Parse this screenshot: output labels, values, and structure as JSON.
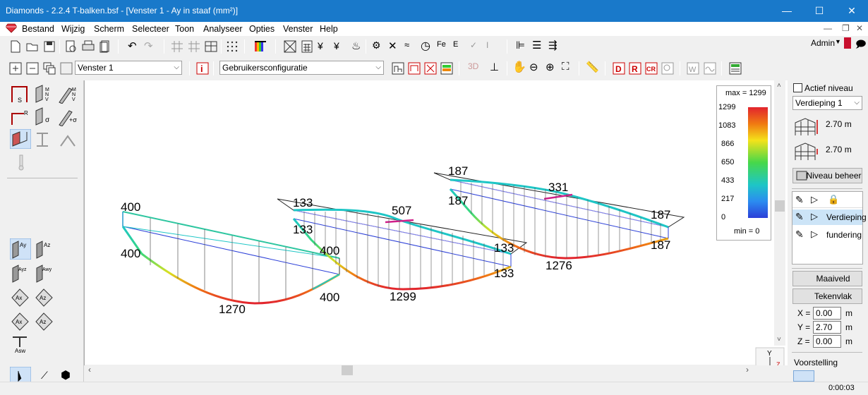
{
  "window": {
    "title": "Diamonds  -  2.2.4 T-balken.bsf - [Venster 1 - Ay in staaf  (mm²)]",
    "minimize": "—",
    "maximize": "☐",
    "close": "✕"
  },
  "menu": {
    "items": [
      "Bestand",
      "Wijzig",
      "Scherm",
      "Selecteer",
      "Toon",
      "Analyseer",
      "Opties",
      "Venster",
      "Help"
    ],
    "user": "Admin"
  },
  "toolbar2": {
    "window_select": "Venster 1",
    "config_select": "Gebruikersconfiguratie"
  },
  "legend": {
    "max_label": "max = 1299",
    "min_label": "min = 0",
    "ticks": [
      "1299",
      "1083",
      "866",
      "650",
      "433",
      "217",
      "0"
    ]
  },
  "beams": {
    "beam1": {
      "left_top": "400",
      "left_bottom": "400",
      "right_bottom": "400",
      "min": "1270"
    },
    "beam2": {
      "left_top": "133",
      "left_bottom": "133",
      "mid_top": "507",
      "right_top": "133",
      "right_bottom": "133",
      "inner": "400",
      "min": "1299"
    },
    "beam3": {
      "left_top": "187",
      "left_bottom": "187",
      "mid_top": "331",
      "right_top": "187",
      "right_bottom": "187",
      "min": "1276"
    }
  },
  "right_panel": {
    "active_level": "Actief niveau",
    "level_select": "Verdieping 1",
    "height1": "2.70 m",
    "height2": "2.70 m",
    "manage_levels": "Niveau beheer",
    "levels": [
      "Verdieping",
      "fundering"
    ],
    "ground_field": "Maaiveld",
    "drawing_plane": "Tekenvlak",
    "x_label": "X =",
    "y_label": "Y =",
    "z_label": "Z =",
    "x_value": "0.00",
    "y_value": "2.70",
    "z_value": "0.00",
    "unit": "m",
    "presentation": "Voorstelling"
  },
  "status": {
    "time": "0:00:03"
  },
  "colors": {
    "titlebar": "#1979ca",
    "accent_red": "#c8102e"
  }
}
